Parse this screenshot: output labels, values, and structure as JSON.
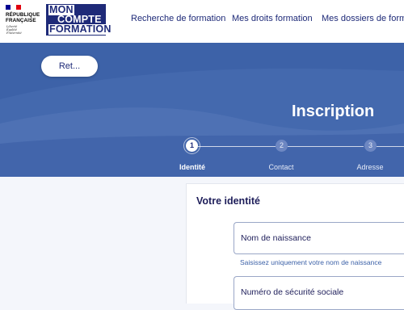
{
  "header": {
    "republic_logo": {
      "line1": "RÉPUBLIQUE",
      "line2": "FRANÇAISE",
      "motto": [
        "Liberté",
        "Égalité",
        "Fraternité"
      ],
      "flag_colors": [
        "#000091",
        "#ffffff",
        "#e1000f"
      ]
    },
    "brand_logo": {
      "line1": "MON",
      "line2": "COMPTE",
      "line3": "FORMATION"
    },
    "nav": [
      {
        "label": "Recherche de formation"
      },
      {
        "label": "Mes droits formation"
      },
      {
        "label": "Mes dossiers de formati"
      }
    ]
  },
  "banner": {
    "back_label": "Ret...",
    "title": "Inscription",
    "steps": [
      {
        "number": "1",
        "label": "Identité",
        "active": true
      },
      {
        "number": "2",
        "label": "Contact",
        "active": false
      },
      {
        "number": "3",
        "label": "Adresse",
        "active": false
      }
    ]
  },
  "form": {
    "section_title": "Votre identité",
    "fields": [
      {
        "label": "Nom de naissance",
        "hint": "Saisissez uniquement votre nom de naissance"
      },
      {
        "label": "Numéro de sécurité sociale"
      }
    ]
  },
  "colors": {
    "brand_navy": "#1e2a78",
    "banner_blue": "#3d62a8",
    "page_background": "#f4f6fb"
  }
}
